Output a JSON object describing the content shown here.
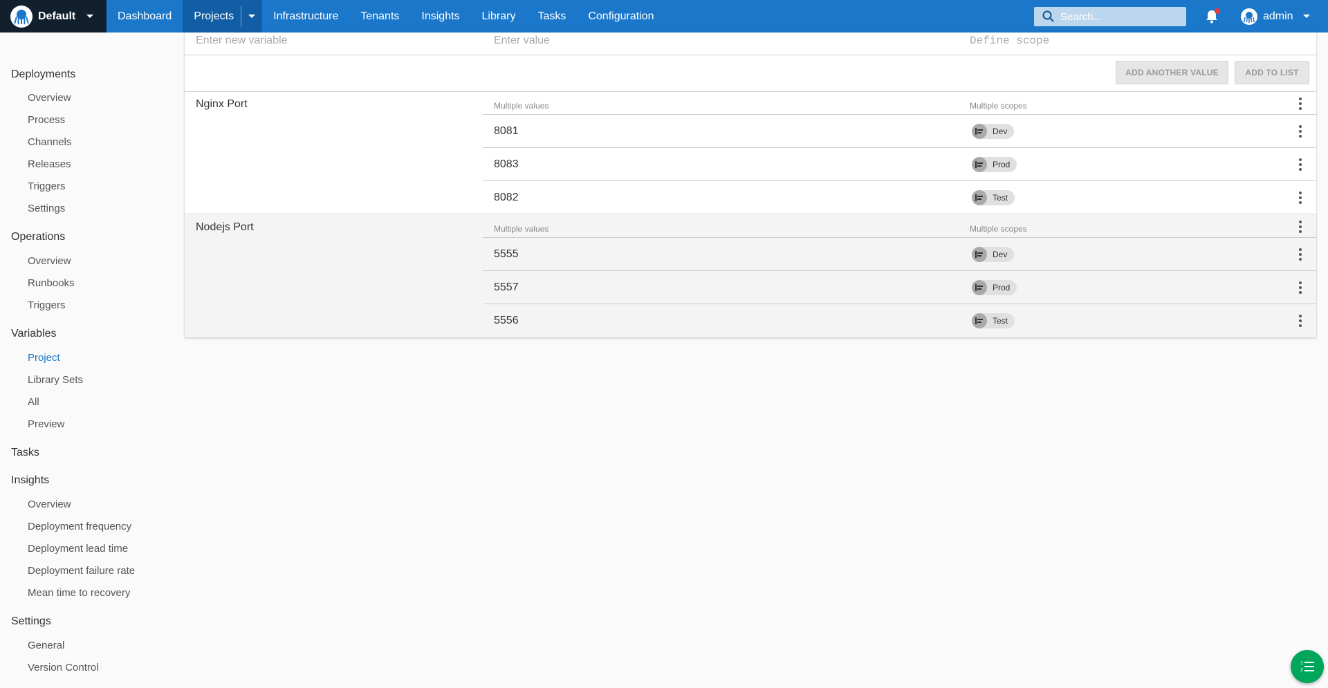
{
  "topbar": {
    "space_name": "Default",
    "nav": [
      "Dashboard",
      "Projects",
      "Infrastructure",
      "Tenants",
      "Insights",
      "Library",
      "Tasks",
      "Configuration"
    ],
    "search_placeholder": "Search...",
    "user_name": "admin",
    "colors": {
      "bar": "#1a77ca",
      "active": "#125ea5",
      "space": "#12202e",
      "notification": "#e5393d"
    }
  },
  "sidebar": {
    "sections": [
      {
        "heading": "Deployments",
        "links": [
          "Overview",
          "Process",
          "Channels",
          "Releases",
          "Triggers",
          "Settings"
        ]
      },
      {
        "heading": "Operations",
        "links": [
          "Overview",
          "Runbooks",
          "Triggers"
        ]
      },
      {
        "heading": "Variables",
        "links": [
          "Project",
          "Library Sets",
          "All",
          "Preview"
        ]
      },
      {
        "heading": "Tasks",
        "links": []
      },
      {
        "heading": "Insights",
        "links": [
          "Overview",
          "Deployment frequency",
          "Deployment lead time",
          "Deployment failure rate",
          "Mean time to recovery"
        ]
      },
      {
        "heading": "Settings",
        "links": [
          "General",
          "Version Control"
        ]
      }
    ],
    "active_link": "Project"
  },
  "editor": {
    "name_placeholder": "Enter new variable",
    "value_placeholder": "Enter value",
    "scope_placeholder": "Define scope",
    "add_another_label": "ADD ANOTHER VALUE",
    "add_to_list_label": "ADD TO LIST"
  },
  "variables": [
    {
      "name": "Nginx Port",
      "values_label": "Multiple values",
      "scopes_label": "Multiple scopes",
      "rows": [
        {
          "value": "8081",
          "scope": "Dev"
        },
        {
          "value": "8083",
          "scope": "Prod"
        },
        {
          "value": "8082",
          "scope": "Test"
        }
      ]
    },
    {
      "name": "Nodejs Port",
      "values_label": "Multiple values",
      "scopes_label": "Multiple scopes",
      "rows": [
        {
          "value": "5555",
          "scope": "Dev"
        },
        {
          "value": "5557",
          "scope": "Prod"
        },
        {
          "value": "5556",
          "scope": "Test"
        }
      ]
    }
  ],
  "fab_icon": "list-numbered-icon",
  "fab_color": "#00a65a"
}
